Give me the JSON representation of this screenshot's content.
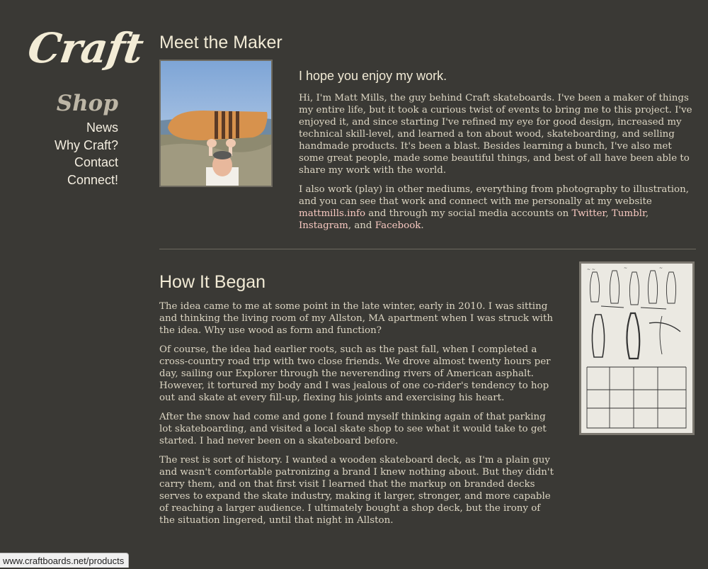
{
  "logo": "Craft",
  "nav": {
    "shop": "Shop",
    "items": [
      "News",
      "Why Craft?",
      "Contact",
      "Connect!"
    ]
  },
  "maker": {
    "heading": "Meet the Maker",
    "lede": "I hope you enjoy my work.",
    "p1": "Hi, I'm Matt Mills, the guy behind Craft skateboards. I've been a maker of things my entire life, but it took a curious twist of events to bring me to this project. I've enjoyed it, and since starting I've refined my eye for good design, increased my technical skill-level, and learned a ton about wood, skateboarding, and selling handmade products. It's been a blast. Besides learning a bunch, I've also met some great people, made some beautiful things, and best of all have been able to share my work with the world.",
    "p2_start": "I also work (play) in other mediums, everything from photography to illustration, and you can see that work and connect with me personally at my website ",
    "link_site": "mattmills.info",
    "p2_mid": " and through my social media accounts on ",
    "link_twitter": "Twitter",
    "sep1": ", ",
    "link_tumblr": "Tumblr",
    "sep2": ", ",
    "link_instagram": "Instagram",
    "sep3": ", and ",
    "link_facebook": "Facebook",
    "p2_end": "."
  },
  "began": {
    "heading": "How It Began",
    "p1": "The idea came to me at some point in the late winter, early in 2010. I was sitting and thinking the living room of my Allston, MA apartment when I was struck with the idea. Why use wood as form and function?",
    "p2": "Of course, the idea had earlier roots, such as the past fall, when I completed a cross-country road trip with two close friends. We drove almost twenty hours per day, sailing our Explorer through the neverending rivers of American asphalt. However, it tortured my body and I was jealous of one co-rider's tendency to hop out and skate at every fill-up, flexing his joints and exercising his heart.",
    "p3": "After the snow had come and gone I found myself thinking again of that parking lot skateboarding, and visited a local skate shop to see what it would take to get started. I had never been on a skateboard before.",
    "p4": "The rest is sort of history. I wanted a wooden skateboard deck, as I'm a plain guy and wasn't comfortable patronizing a brand I knew nothing about. But they didn't carry them, and on that first visit I learned that the markup on branded decks serves to expand the skate industry, making it larger, stronger, and more capable of reaching a larger audience. I ultimately bought a shop deck, but the irony of the situation lingered, until that night in Allston."
  },
  "status_url": "www.craftboards.net/products"
}
